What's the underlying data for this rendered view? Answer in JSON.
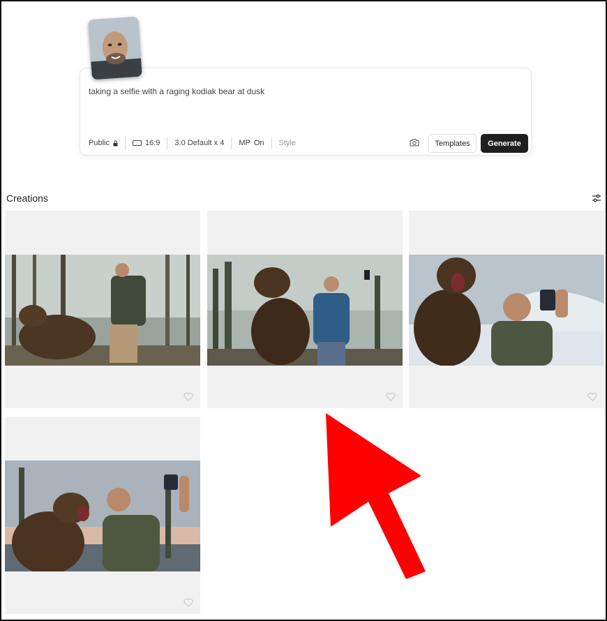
{
  "prompt": {
    "text": "taking a selfie with a raging kodiak bear at dusk",
    "visibility": "Public",
    "aspect_ratio": "16:9",
    "model": "3.0 Default x 4",
    "mp_label": "MP",
    "mp_value": "On",
    "style_label": "Style",
    "templates_label": "Templates",
    "generate_label": "Generate"
  },
  "creations": {
    "title": "Creations",
    "items": [
      {
        "alt": "man with bear in misty forest"
      },
      {
        "alt": "man taking selfie next to standing bear"
      },
      {
        "alt": "man taking selfie with roaring bear in snow"
      },
      {
        "alt": "man taking selfie with roaring bear at lake"
      }
    ]
  },
  "colors": {
    "accent": "#1f1f1f",
    "arrow": "#ff0000",
    "tile_bg": "#f1f1f1"
  }
}
